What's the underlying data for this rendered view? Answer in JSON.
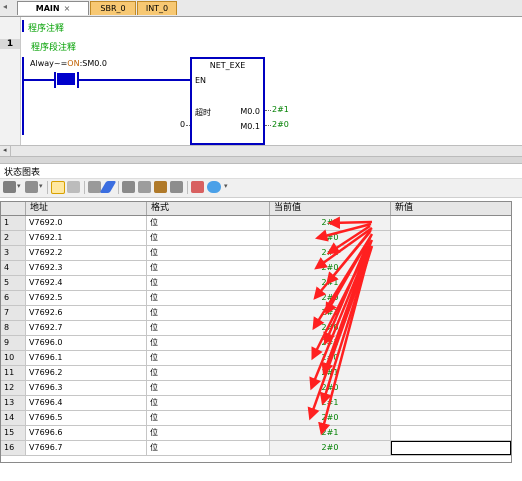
{
  "tabs": [
    {
      "label": "MAIN",
      "close": "×"
    },
    {
      "label": "SBR_0"
    },
    {
      "label": "INT_0"
    }
  ],
  "ladder": {
    "program_comment": "程序注释",
    "network_number": "1",
    "network_comment": "程序段注释",
    "contact_prefix": "Alway~=",
    "contact_on": "ON",
    "contact_suffix": ":SM0.0",
    "block_name": "NET_EXE",
    "en_label": "EN",
    "timeout_label": "超时",
    "timeout_input": "0",
    "out1_param": "M0.0",
    "out1_value": "2#1",
    "out2_param": "M0.1",
    "out2_value": "2#0"
  },
  "status_chart": {
    "title": "状态图表",
    "columns": {
      "num": "",
      "address": "地址",
      "format": "格式",
      "current": "当前值",
      "new": "新值"
    },
    "rows": [
      {
        "num": "1",
        "address": "V7692.0",
        "format": "位",
        "current": "2#1",
        "new": ""
      },
      {
        "num": "2",
        "address": "V7692.1",
        "format": "位",
        "current": "2#0",
        "new": ""
      },
      {
        "num": "3",
        "address": "V7692.2",
        "format": "位",
        "current": "2#1",
        "new": ""
      },
      {
        "num": "4",
        "address": "V7692.3",
        "format": "位",
        "current": "2#0",
        "new": ""
      },
      {
        "num": "5",
        "address": "V7692.4",
        "format": "位",
        "current": "2#1",
        "new": ""
      },
      {
        "num": "6",
        "address": "V7692.5",
        "format": "位",
        "current": "2#0",
        "new": ""
      },
      {
        "num": "7",
        "address": "V7692.6",
        "format": "位",
        "current": "2#1",
        "new": ""
      },
      {
        "num": "8",
        "address": "V7692.7",
        "format": "位",
        "current": "2#0",
        "new": ""
      },
      {
        "num": "9",
        "address": "V7696.0",
        "format": "位",
        "current": "2#1",
        "new": ""
      },
      {
        "num": "10",
        "address": "V7696.1",
        "format": "位",
        "current": "2#0",
        "new": ""
      },
      {
        "num": "11",
        "address": "V7696.2",
        "format": "位",
        "current": "2#1",
        "new": ""
      },
      {
        "num": "12",
        "address": "V7696.3",
        "format": "位",
        "current": "2#0",
        "new": ""
      },
      {
        "num": "13",
        "address": "V7696.4",
        "format": "位",
        "current": "2#1",
        "new": ""
      },
      {
        "num": "14",
        "address": "V7696.5",
        "format": "位",
        "current": "2#0",
        "new": ""
      },
      {
        "num": "15",
        "address": "V7696.6",
        "format": "位",
        "current": "2#1",
        "new": ""
      },
      {
        "num": "16",
        "address": "V7696.7",
        "format": "位",
        "current": "2#0",
        "new": ""
      }
    ]
  },
  "colors": {
    "accent": "#0000c0",
    "comment": "#00a000",
    "value": "#008000",
    "annotation_arrow": "#ff2020",
    "tab_orange": "#f7c873"
  },
  "icons": [
    "add-icon",
    "delete-icon",
    "trend-icon",
    "table-icon",
    "pencil-icon",
    "write-icon",
    "force-icon",
    "unforce-icon",
    "read-icon",
    "chart-icon",
    "watch-icon"
  ]
}
